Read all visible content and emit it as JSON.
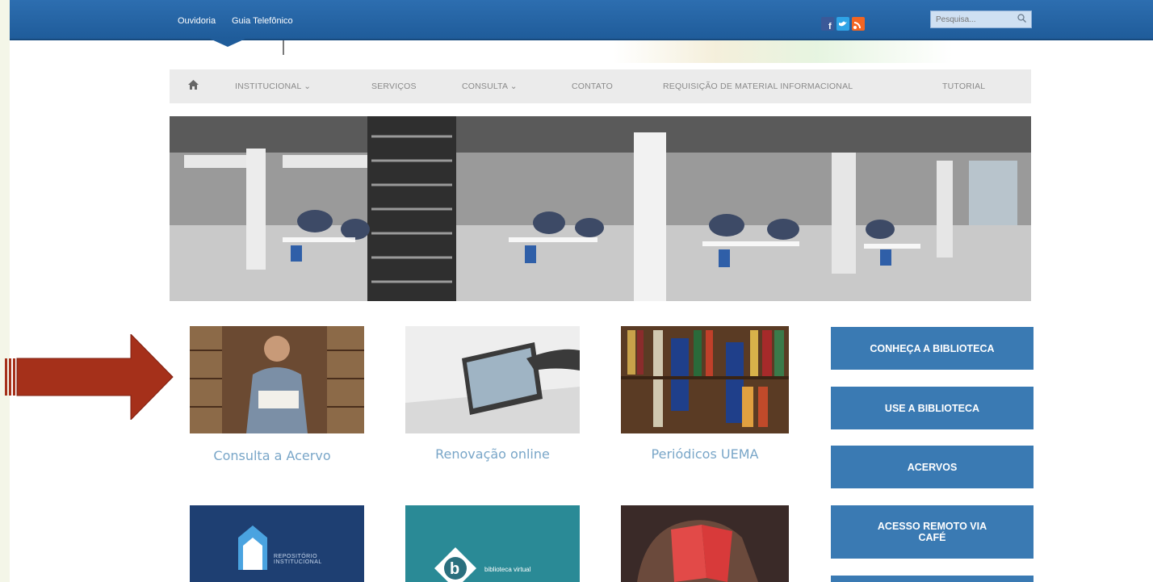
{
  "topbar": {
    "links": [
      "Ouvidoria",
      "Guia Telefônico"
    ],
    "social": [
      {
        "name": "facebook",
        "color": "#3b5998"
      },
      {
        "name": "twitter",
        "color": "#2fa3e6"
      },
      {
        "name": "rss",
        "color": "#f26522"
      }
    ],
    "search_placeholder": "Pesquisa...",
    "search_icon": "search-icon"
  },
  "nav": {
    "home_icon": "home-icon",
    "items": [
      "INSTITUCIONAL  ⌄",
      "SERVIÇOS",
      "CONSULTA  ⌄",
      "CONTATO",
      "REQUISIÇÃO DE MATERIAL INFORMACIONAL",
      "TUTORIAL"
    ]
  },
  "tiles": {
    "row1": [
      {
        "caption": "Consulta a Acervo",
        "image": "student-reading-in-library"
      },
      {
        "caption": "Renovação online",
        "image": "hand-on-tablet"
      },
      {
        "caption": "Periódicos UEMA",
        "image": "bookshelf"
      }
    ],
    "row2": [
      {
        "label": "REPOSITÓRIO INSTITUCIONAL",
        "image": "repositorio-logo"
      },
      {
        "label": "biblioteca virtual",
        "image": "biblioteca-virtual-logo"
      },
      {
        "label": "",
        "image": "person-reading-red-book"
      }
    ]
  },
  "sidebar_buttons": [
    "CONHEÇA A BIBLIOTECA",
    "USE A BIBLIOTECA",
    "ACERVOS",
    "ACESSO REMOTO VIA CAFÉ"
  ],
  "colors": {
    "topbar": "#1f5c9a",
    "button": "#3a7ab3",
    "caption": "#79a6c8",
    "arrow": "#a5301a"
  }
}
